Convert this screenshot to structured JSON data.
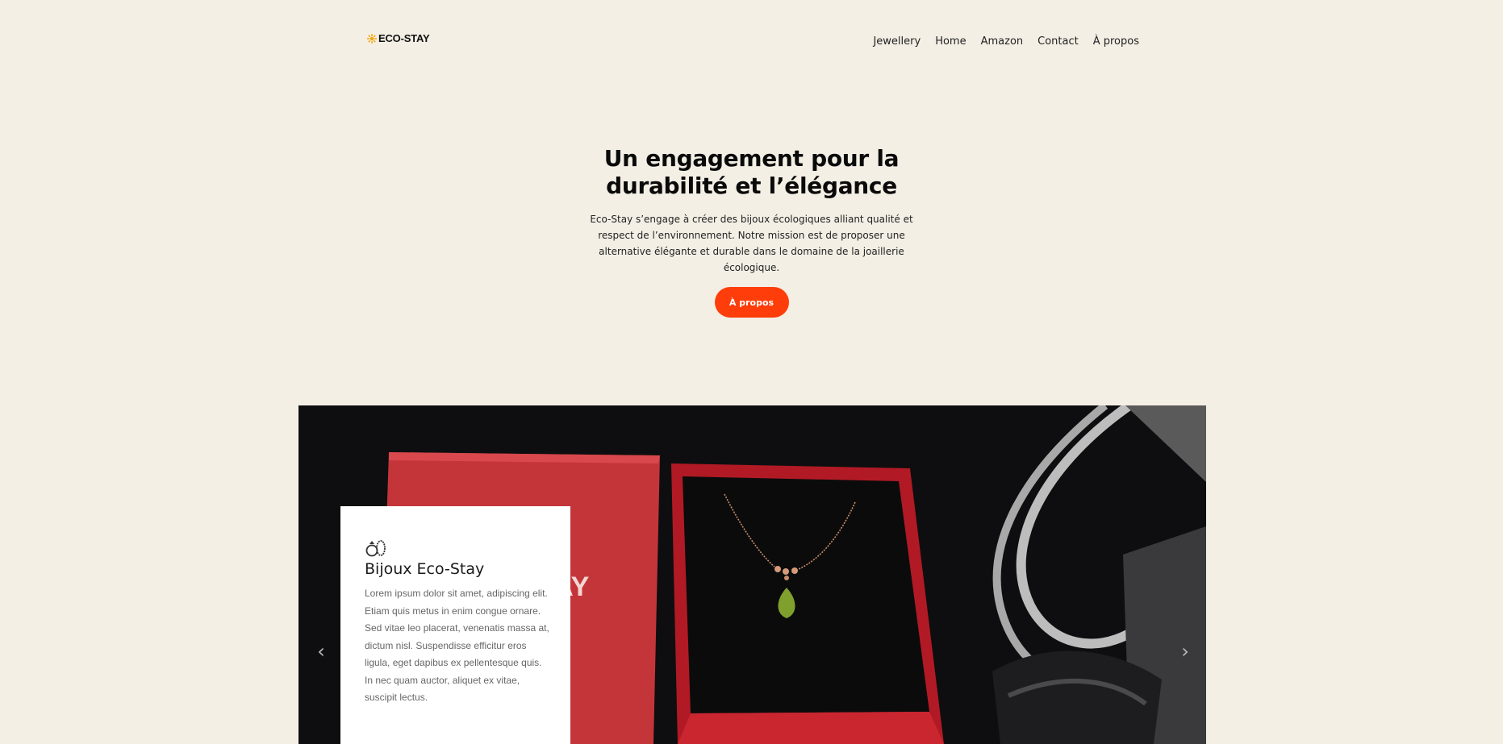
{
  "header": {
    "logo_text": "ECO-STAY",
    "nav": [
      "Jewellery",
      "Home",
      "Amazon",
      "Contact",
      "À propos"
    ]
  },
  "hero": {
    "title": "Un engagement pour la durabilité et l’élégance",
    "description": "Eco-Stay s’engage à créer des bijoux écologiques alliant qualité et respect de l’environnement. Notre mission est de proposer une alternative élégante et durable dans le domaine de la joaillerie écologique.",
    "cta_label": "À propos"
  },
  "slider": {
    "prev_icon": "chevron-left-icon",
    "next_icon": "chevron-right-icon",
    "box_text": "TAY",
    "card": {
      "icon": "rings-icon",
      "title": "Bijoux Eco-Stay",
      "body": "Lorem ipsum dolor sit amet, adipiscing elit. Etiam quis metus in enim congue ornare. Sed vitae leo placerat, venenatis massa at, dictum nisl. Suspendisse efficitur eros ligula, eget dapibus ex pellentesque quis. In nec quam auctor, aliquet ex vitae, suscipit lectus."
    }
  },
  "colors": {
    "background": "#f4efe5",
    "accent": "#ff3d0a",
    "logo_star": "#f5a300"
  }
}
